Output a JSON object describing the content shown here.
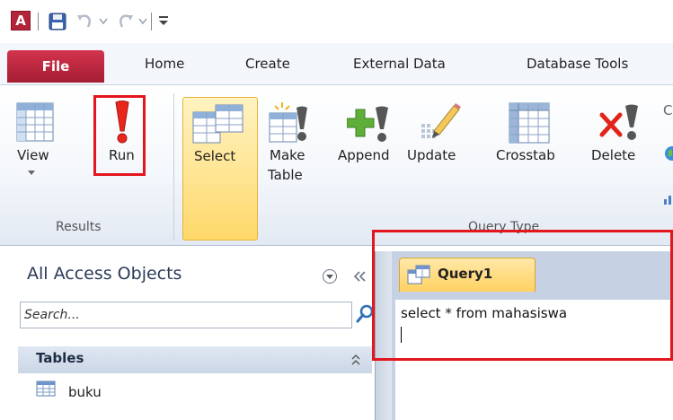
{
  "app": {
    "logo_letter": "A"
  },
  "tabs": [
    "File",
    "Home",
    "Create",
    "External Data",
    "Database Tools"
  ],
  "ribbon": {
    "results_group": {
      "label": "Results",
      "view": "View",
      "run": "Run"
    },
    "query_type_group": {
      "label": "Query Type",
      "select": "Select",
      "make_table_line1": "Make",
      "make_table_line2": "Table",
      "append": "Append",
      "update": "Update",
      "crosstab": "Crosstab",
      "delete": "Delete"
    }
  },
  "nav_pane": {
    "title": "All Access Objects",
    "search_placeholder": "Search...",
    "section": "Tables",
    "items": [
      "buku"
    ]
  },
  "document": {
    "tab_label": "Query1",
    "sql_text": "select * from mahasiswa"
  },
  "colors": {
    "file_tab": "#c4263f",
    "highlight": "#ffd86b",
    "annotation_red": "#e2161c"
  }
}
